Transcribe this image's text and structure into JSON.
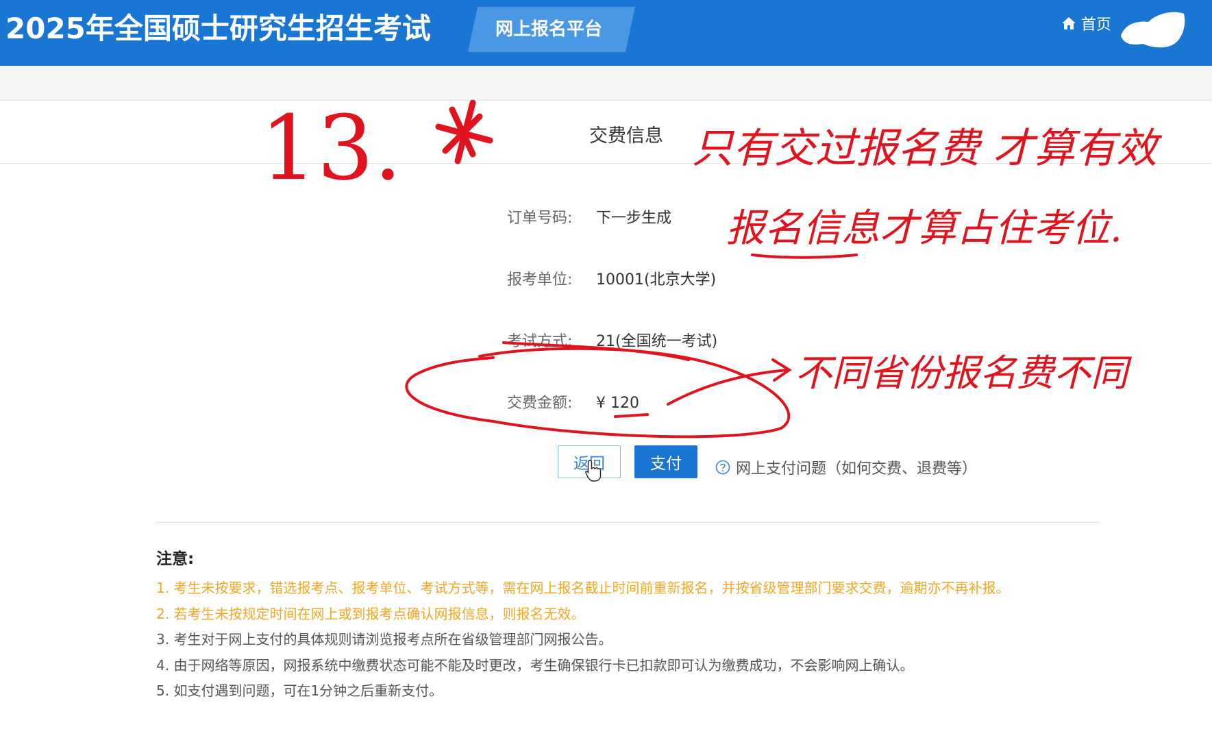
{
  "header": {
    "site_title": "2025年全国硕士研究生招生考试",
    "platform_label": "网上报名平台",
    "home_label": "首页",
    "home_icon": "home-icon",
    "background": "#1976d2"
  },
  "section": {
    "title": "交费信息"
  },
  "form": {
    "rows": [
      {
        "label": "订单号码:",
        "value": "下一步生成"
      },
      {
        "label": "报考单位:",
        "value": "10001(北京大学)"
      },
      {
        "label": "考试方式:",
        "value": "21(全国统一考试)"
      },
      {
        "label": "交费金额:",
        "value": "¥ 120"
      }
    ]
  },
  "actions": {
    "back_label": "返回",
    "pay_label": "支付",
    "help_label": "网上支付问题（如何交费、退费等）",
    "help_icon": "question-circle-icon",
    "accent": "#1976d2"
  },
  "notice": {
    "title": "注意:",
    "items": [
      {
        "text": "1. 考生未按要求，错选报考点、报考单位、考试方式等，需在网上报名截止时间前重新报名，并按省级管理部门要求交费，逾期亦不再补报。",
        "color": "#f5a623"
      },
      {
        "text": "2. 若考生未按规定时间在网上或到报考点确认网报信息，则报名无效。",
        "color": "#f5a623"
      },
      {
        "text": "3. 考生对于网上支付的具体规则请浏览报考点所在省级管理部门网报公告。",
        "color": "#555555"
      },
      {
        "text": "4. 由于网络等原因，网报系统中缴费状态可能不能及时更改，考生确保银行卡已扣款即可认为缴费成功，不会影响网上确认。",
        "color": "#555555"
      },
      {
        "text": "5. 如支付遇到问题，可在1分钟之后重新支付。",
        "color": "#555555"
      }
    ]
  },
  "annotations": {
    "step_number": "13.",
    "note_line1": "只有交过报名费 才算有效",
    "note_line2": "报名信息才算占住考位.",
    "note_fee": "不同省份报名费不同",
    "ink_color": "#e0141e"
  }
}
